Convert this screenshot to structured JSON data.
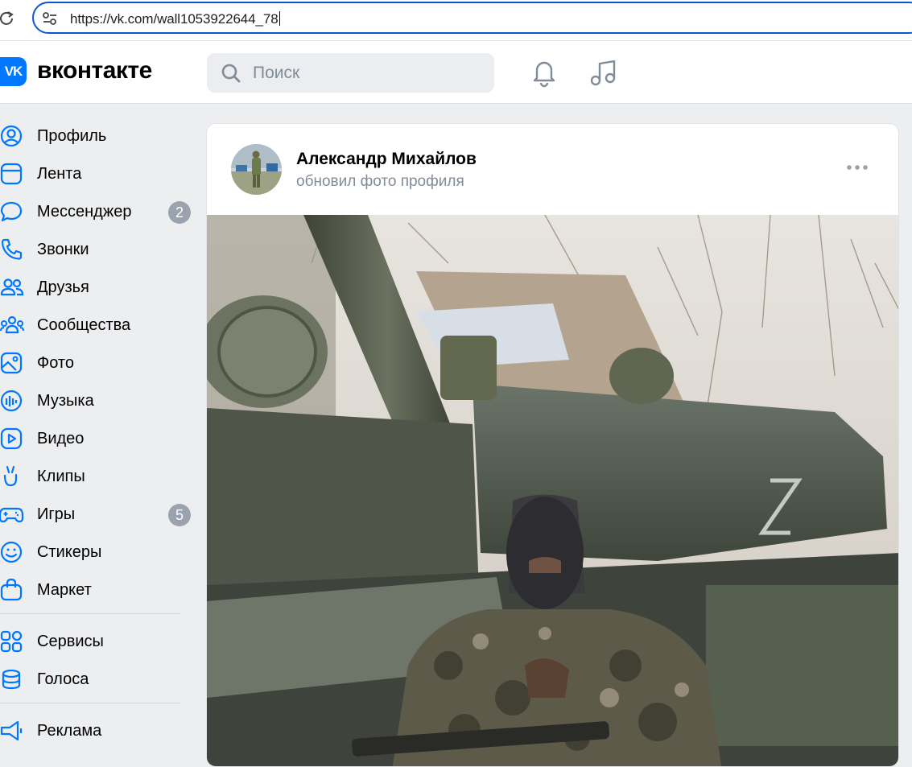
{
  "browser": {
    "url": "https://vk.com/wall1053922644_78",
    "reload_icon": "reload-icon",
    "site_info_icon": "tune-icon"
  },
  "header": {
    "logo_text": "VK",
    "wordmark": "вконтакте",
    "search_placeholder": "Поиск",
    "icons": [
      "bell-icon",
      "music-note-icon"
    ],
    "brand_color": "#0077ff"
  },
  "sidebar": {
    "items": [
      {
        "label": "Профиль",
        "icon": "profile-icon"
      },
      {
        "label": "Лента",
        "icon": "feed-icon"
      },
      {
        "label": "Мессенджер",
        "icon": "messenger-icon",
        "badge": "2"
      },
      {
        "label": "Звонки",
        "icon": "phone-icon"
      },
      {
        "label": "Друзья",
        "icon": "friends-icon"
      },
      {
        "label": "Сообщества",
        "icon": "communities-icon"
      },
      {
        "label": "Фото",
        "icon": "photo-icon"
      },
      {
        "label": "Музыка",
        "icon": "music-icon"
      },
      {
        "label": "Видео",
        "icon": "video-icon"
      },
      {
        "label": "Клипы",
        "icon": "clips-icon"
      },
      {
        "label": "Игры",
        "icon": "games-icon",
        "badge": "5"
      },
      {
        "label": "Стикеры",
        "icon": "stickers-icon"
      },
      {
        "label": "Маркет",
        "icon": "market-icon"
      }
    ],
    "secondary": [
      {
        "label": "Сервисы",
        "icon": "services-icon"
      },
      {
        "label": "Голоса",
        "icon": "votes-icon"
      }
    ],
    "tertiary": [
      {
        "label": "Реклама",
        "icon": "ads-icon"
      }
    ],
    "icon_color": "#0077ff",
    "badge_color": "#99a2ad"
  },
  "post": {
    "author": "Александр Михайлов",
    "action": "обновил фото профиля",
    "more_icon": "more-horizontal-icon",
    "photo_icon": "photo-post-image"
  }
}
